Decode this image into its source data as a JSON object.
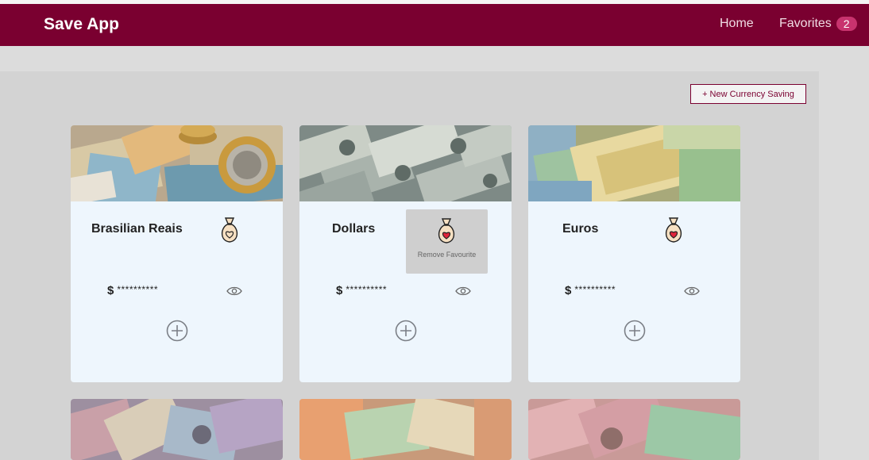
{
  "navbar": {
    "brand": "Save App",
    "home_label": "Home",
    "favorites_label": "Favorites",
    "favorites_count": "2"
  },
  "toolbar": {
    "new_button_label": "+ New Currency Saving"
  },
  "cards": [
    {
      "title": "Brasilian Reais",
      "currency_symbol": "$",
      "masked_amount": "**********"
    },
    {
      "title": "Dollars",
      "currency_symbol": "$",
      "masked_amount": "**********",
      "hover_label": "Remove Favourite"
    },
    {
      "title": "Euros",
      "currency_symbol": "$",
      "masked_amount": "**********"
    }
  ],
  "icons": {
    "favorite": "money-bag-heart-icon",
    "visibility": "eye-icon",
    "add": "plus-circle-icon"
  },
  "colors": {
    "brand": "#7a0030",
    "badge": "#c8336e",
    "card_bg": "#eef6fd"
  }
}
